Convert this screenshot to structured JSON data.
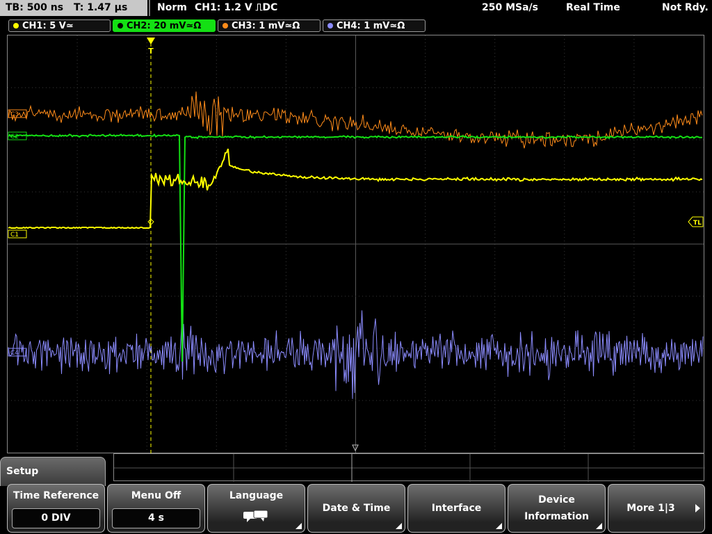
{
  "topbar": {
    "timebase": "TB: 500 ns",
    "trigger_pos": "T: 1.47 µs",
    "trigger_mode": "Norm",
    "trigger_info": "CH1: 1.2 V ⎍DC",
    "sample_rate": "250 MSa/s",
    "acq_mode": "Real Time",
    "status": "Not Rdy."
  },
  "channels": [
    {
      "label": "CH1: 5 V≃",
      "color": "#ffff00"
    },
    {
      "label": "CH2: 20 mV≃Ω",
      "color": "#14e014"
    },
    {
      "label": "CH3: 1 mV≃Ω",
      "color": "#ff8c1a"
    },
    {
      "label": "CH4: 1 mV≃Ω",
      "color": "#8c8cff"
    }
  ],
  "markers": {
    "trigger": "T",
    "trigger_level": "TL",
    "ch1": "C1",
    "ch2": "C2",
    "ch3": "C3",
    "ch4": "C4"
  },
  "menu": {
    "title": "Setup",
    "softkeys": [
      {
        "label": "Time Reference",
        "value": "0 DIV"
      },
      {
        "label": "Menu Off",
        "value": "4 s"
      },
      {
        "label": "Language",
        "icon": "speech-bubbles-icon"
      },
      {
        "label": "Date & Time"
      },
      {
        "label": "Interface"
      },
      {
        "label": "Device Information"
      },
      {
        "label": "More 1|3"
      }
    ]
  }
}
